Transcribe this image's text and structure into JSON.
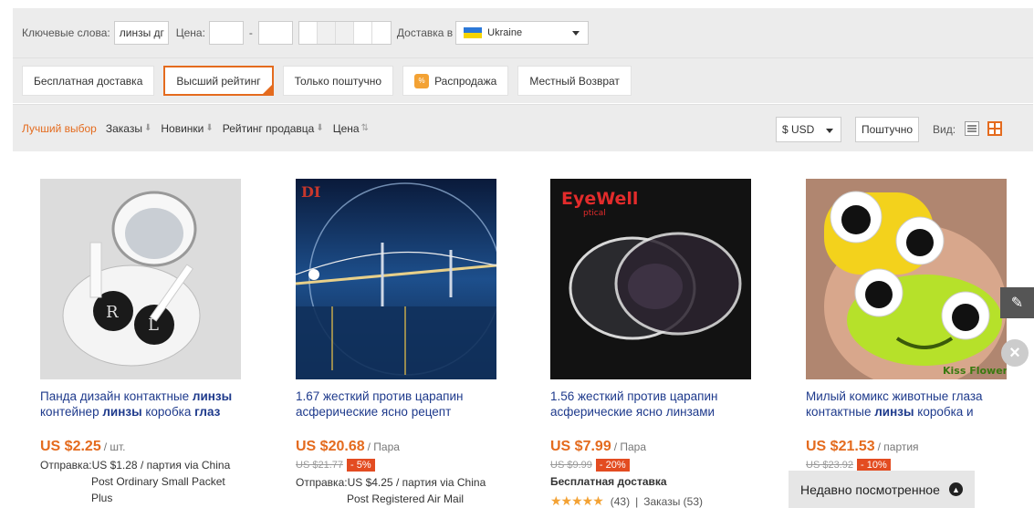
{
  "filters": {
    "keywords_label": "Ключевые слова:",
    "keywords_value": "линзы дг",
    "price_label": "Цена:",
    "price_dash": "-",
    "ship_to_label": "Доставка в",
    "country": "Ukraine"
  },
  "toggles": [
    {
      "label": "Бесплатная доставка"
    },
    {
      "label": "Высший рейтинг"
    },
    {
      "label": "Только поштучно"
    },
    {
      "label": "Распродажа",
      "icon_text": "%"
    },
    {
      "label": "Местный Возврат"
    }
  ],
  "sort": {
    "items": [
      "Лучший выбор",
      "Заказы",
      "Новинки",
      "Рейтинг продавца",
      "Цена"
    ],
    "currency": "$ USD",
    "piece_button": "Поштучно",
    "view_label": "Вид:"
  },
  "products": [
    {
      "title_parts": [
        "Панда дизайн контактные ",
        "линзы",
        " контейнер ",
        "линзы",
        " коробка ",
        "глаз"
      ],
      "price": "US $2.25",
      "unit": "/ шт.",
      "ship_line1": "Отправка:US $1.28 / партия via China",
      "ship_line2": "Post Ordinary Small Packet",
      "ship_line3": "Plus"
    },
    {
      "title_parts": [
        "1.67 жесткий против царапин асферические ясно рецепт"
      ],
      "price": "US $20.68",
      "unit": "/ Пара",
      "old_price": "US $21.77",
      "discount": "- 5%",
      "ship_line1": "Отправка:US $4.25 / партия via China",
      "ship_line2": "Post Registered Air Mail",
      "brand_text": "DI"
    },
    {
      "title_parts": [
        "1.56 жесткий против царапин асферические ясно линзами"
      ],
      "price": "US $7.99",
      "unit": "/ Пара",
      "old_price": "US $9.99",
      "discount": "- 20%",
      "free_shipping": "Бесплатная доставка",
      "rating_count": "(43)",
      "orders": "Заказы (53)",
      "separator": "|",
      "brand_text": "EyeWell",
      "brand_sub": "ptical"
    },
    {
      "title_parts": [
        "Милый комикс животные глаза контактные ",
        "линзы",
        " коробка и"
      ],
      "price": "US $21.53",
      "unit": "/ партия",
      "old_price": "US $23.92",
      "discount": "- 10%",
      "brand_text": "Kiss Flower"
    }
  ],
  "recently_viewed": "Недавно посмотренное",
  "colors": {
    "accent": "#e46b1e",
    "link": "#1e3a8c",
    "discount": "#e34c21",
    "panel": "#ececec"
  }
}
